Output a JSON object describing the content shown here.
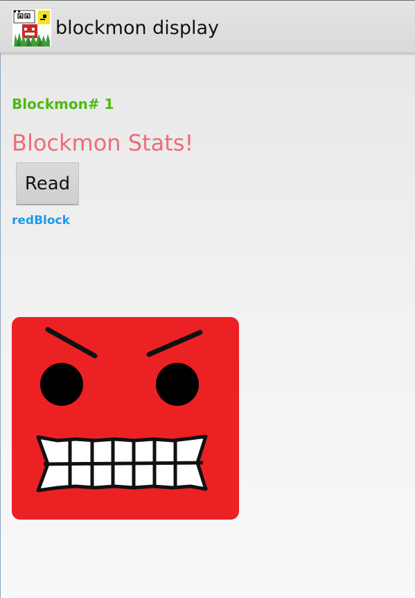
{
  "app": {
    "title": "blockmon display",
    "icon": "blockmon-app-icon"
  },
  "content": {
    "blockmon_number": "Blockmon# 1",
    "stats_heading": "Blockmon Stats!",
    "read_button_label": "Read",
    "block_name": "redBlock",
    "image": "angry-red-block-face"
  },
  "colors": {
    "number_text": "#4cbb10",
    "heading_text": "#ee6c78",
    "block_name_text": "#1e9ae8",
    "block_face": "#ec2124"
  }
}
